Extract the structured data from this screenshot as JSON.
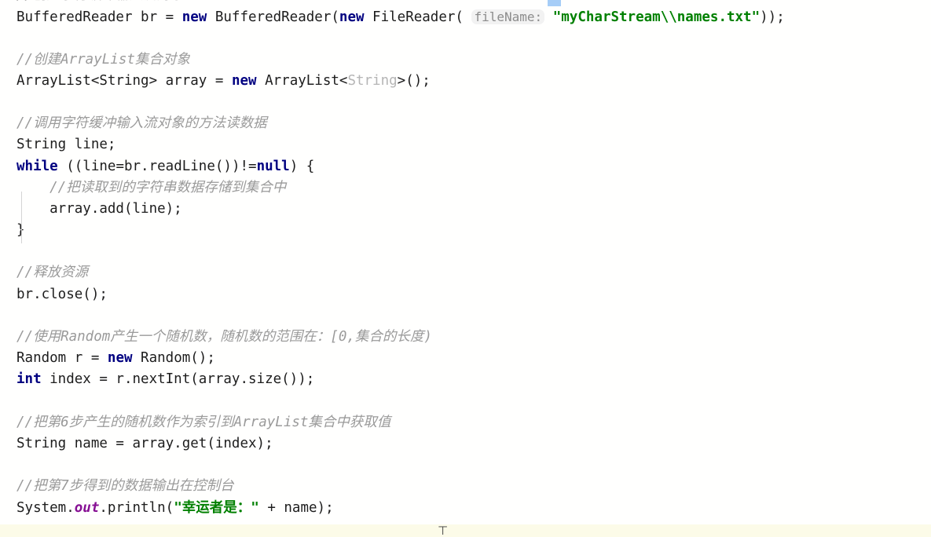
{
  "editor": {
    "language": "Java",
    "background_color": "#fffffe",
    "default_text_color": "#1d1d1d",
    "colors": {
      "keyword": "#000080",
      "string": "#008000",
      "comment": "#9a9a9a",
      "static_field": "#871094",
      "inferred_type_dim": "#b5b5b5",
      "parameter_hint_text": "#8c8c8c",
      "parameter_hint_background": "#f2f2f2",
      "selection_highlight": "#a6cdf7",
      "indent_guide": "#d4d4d4",
      "bottom_band": "#fcfbe8"
    }
  },
  "lines": [
    {
      "id": "l0",
      "type": "clipped",
      "text": "//创建字符缓冲输入流对象"
    },
    {
      "id": "l1",
      "type": "code",
      "tokens": [
        {
          "t": "BufferedReader br = ",
          "c": "ident"
        },
        {
          "t": "new",
          "c": "kw"
        },
        {
          "t": " BufferedReader(",
          "c": "ident"
        },
        {
          "t": "new",
          "c": "kw"
        },
        {
          "t": " FileReader( ",
          "c": "ident"
        },
        {
          "t": "fileName:",
          "c": "hint"
        },
        {
          "t": " ",
          "c": "ident"
        },
        {
          "t": "\"myCharStream\\\\names.txt\"",
          "c": "str"
        },
        {
          "t": "));",
          "c": "ident"
        }
      ]
    },
    {
      "id": "l2",
      "type": "blank"
    },
    {
      "id": "l3",
      "type": "comment",
      "tokens": [
        {
          "t": "//创建ArrayList集合对象",
          "c": "cmt"
        }
      ]
    },
    {
      "id": "l4",
      "type": "code",
      "tokens": [
        {
          "t": "ArrayList<String> array = ",
          "c": "ident"
        },
        {
          "t": "new",
          "c": "kw"
        },
        {
          "t": " ArrayList<",
          "c": "ident"
        },
        {
          "t": "String",
          "c": "dim"
        },
        {
          "t": ">();",
          "c": "ident"
        }
      ]
    },
    {
      "id": "l5",
      "type": "blank"
    },
    {
      "id": "l6",
      "type": "comment",
      "tokens": [
        {
          "t": "//调用字符缓冲输入流对象的方法读数据",
          "c": "cmt"
        }
      ]
    },
    {
      "id": "l7",
      "type": "code",
      "tokens": [
        {
          "t": "String line;",
          "c": "ident"
        }
      ]
    },
    {
      "id": "l8",
      "type": "code",
      "tokens": [
        {
          "t": "while",
          "c": "kw"
        },
        {
          "t": " ((line=br.readLine())!=",
          "c": "ident"
        },
        {
          "t": "null",
          "c": "kw"
        },
        {
          "t": ") {",
          "c": "ident"
        }
      ]
    },
    {
      "id": "l9",
      "type": "comment",
      "tokens": [
        {
          "t": "    //把读取到的字符串数据存储到集合中",
          "c": "cmt"
        }
      ]
    },
    {
      "id": "l10",
      "type": "code",
      "tokens": [
        {
          "t": "    array.add(line);",
          "c": "ident"
        }
      ]
    },
    {
      "id": "l11",
      "type": "code",
      "tokens": [
        {
          "t": "}",
          "c": "ident"
        }
      ]
    },
    {
      "id": "l12",
      "type": "blank"
    },
    {
      "id": "l13",
      "type": "comment",
      "tokens": [
        {
          "t": "//释放资源",
          "c": "cmt"
        }
      ]
    },
    {
      "id": "l14",
      "type": "code",
      "tokens": [
        {
          "t": "br.close();",
          "c": "ident"
        }
      ]
    },
    {
      "id": "l15",
      "type": "blank"
    },
    {
      "id": "l16",
      "type": "comment",
      "tokens": [
        {
          "t": "//使用Random产生一个随机数，随机数的范围在：[0,集合的长度)",
          "c": "cmt"
        }
      ]
    },
    {
      "id": "l17",
      "type": "code",
      "tokens": [
        {
          "t": "Random r = ",
          "c": "ident"
        },
        {
          "t": "new",
          "c": "kw"
        },
        {
          "t": " Random();",
          "c": "ident"
        }
      ]
    },
    {
      "id": "l18",
      "type": "code",
      "tokens": [
        {
          "t": "int",
          "c": "kw"
        },
        {
          "t": " index = r.nextInt(array.size());",
          "c": "ident"
        }
      ]
    },
    {
      "id": "l19",
      "type": "blank"
    },
    {
      "id": "l20",
      "type": "comment",
      "tokens": [
        {
          "t": "//把第6步产生的随机数作为索引到ArrayList集合中获取值",
          "c": "cmt"
        }
      ]
    },
    {
      "id": "l21",
      "type": "code",
      "tokens": [
        {
          "t": "String name = array.get(index);",
          "c": "ident"
        }
      ]
    },
    {
      "id": "l22",
      "type": "blank"
    },
    {
      "id": "l23",
      "type": "comment",
      "tokens": [
        {
          "t": "//把第7步得到的数据输出在控制台",
          "c": "cmt"
        }
      ]
    },
    {
      "id": "l24",
      "type": "code",
      "tokens": [
        {
          "t": "System.",
          "c": "ident"
        },
        {
          "t": "out",
          "c": "field"
        },
        {
          "t": ".println(",
          "c": "ident"
        },
        {
          "t": "\"幸运者是：\"",
          "c": "str"
        },
        {
          "t": " + name);",
          "c": "ident"
        }
      ]
    }
  ],
  "caret": {
    "glyph": "⊤",
    "label": "text-cursor"
  }
}
